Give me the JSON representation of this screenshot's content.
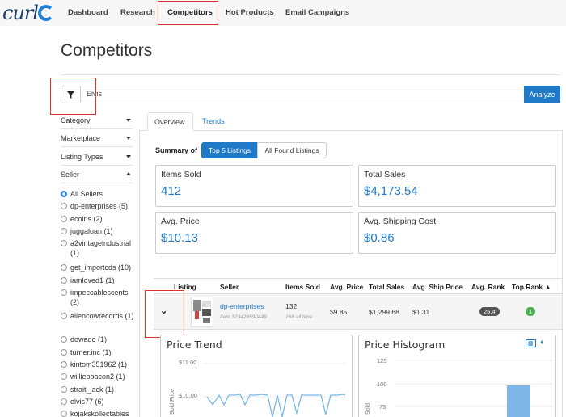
{
  "brand": {
    "logo_text": "curl"
  },
  "nav": [
    {
      "label": "Dashboard"
    },
    {
      "label": "Research"
    },
    {
      "label": "Competitors"
    },
    {
      "label": "Hot Products"
    },
    {
      "label": "Email Campaigns"
    }
  ],
  "page": {
    "title": "Competitors"
  },
  "search": {
    "value": "Elvis",
    "analyze_label": "Analyze"
  },
  "filters": [
    {
      "label": "Category",
      "expanded": false
    },
    {
      "label": "Marketplace",
      "expanded": false
    },
    {
      "label": "Listing Types",
      "expanded": false
    },
    {
      "label": "Seller",
      "expanded": true
    }
  ],
  "sellers": [
    {
      "label": "All Sellers",
      "selected": true
    },
    {
      "label": "dp-enterprises (5)",
      "selected": false
    },
    {
      "label": "ecoins (2)",
      "selected": false
    },
    {
      "label": "juggaloan (1)",
      "selected": false
    },
    {
      "label": "a2vintageindustrial (1)",
      "selected": false
    },
    {
      "label": "get_importcds (10)",
      "selected": false
    },
    {
      "label": "iamloved1 (1)",
      "selected": false
    },
    {
      "label": "impeccablescents (2)",
      "selected": false
    },
    {
      "label": "aliencowrecords (1)",
      "selected": false
    },
    {
      "label": "dowado (1)",
      "selected": false
    },
    {
      "label": "turner.inc (1)",
      "selected": false
    },
    {
      "label": "kintom351962 (1)",
      "selected": false
    },
    {
      "label": "williebbacon2 (1)",
      "selected": false
    },
    {
      "label": "strait_jack (1)",
      "selected": false
    },
    {
      "label": "elvis77 (6)",
      "selected": false
    },
    {
      "label": "kojakskollectables",
      "selected": false
    }
  ],
  "tabs": [
    {
      "label": "Overview"
    },
    {
      "label": "Trends"
    }
  ],
  "summary": {
    "label": "Summary of",
    "options": [
      {
        "label": "Top 5 Listings"
      },
      {
        "label": "All Found Listings"
      }
    ]
  },
  "stats": [
    {
      "label": "Items Sold",
      "value": "412"
    },
    {
      "label": "Total Sales",
      "value": "$4,173.54"
    },
    {
      "label": "Avg. Price",
      "value": "$10.13"
    },
    {
      "label": "Avg. Shipping Cost",
      "value": "$0.86"
    }
  ],
  "table": {
    "headers": [
      "Listing",
      "Seller",
      "Items Sold",
      "Avg. Price",
      "Total Sales",
      "Avg. Ship Price",
      "Avg. Rank",
      "Top Rank ▲"
    ],
    "rows": [
      {
        "seller": "dp-enterprises",
        "item": "Item 323428590449",
        "items_sold": "132",
        "sold_sub": "168 all time",
        "avg_price": "$9.85",
        "total_sales": "$1,299.68",
        "avg_ship": "$1.31",
        "avg_rank": "25.4",
        "top_rank": "1"
      }
    ]
  },
  "price_trend": {
    "title": "Price Trend",
    "ylabel": "Sold Price",
    "ticks": [
      "$11.00",
      "$10.00"
    ]
  },
  "price_histogram": {
    "title": "Price Histogram",
    "ylabel": "Sold",
    "ticks": [
      "125",
      "100",
      "75"
    ]
  },
  "colors": {
    "accent": "#2079c7",
    "highlight_box": "#d9342b",
    "trend_line": "#7ab8e6",
    "bar": "#7fb6e8"
  }
}
